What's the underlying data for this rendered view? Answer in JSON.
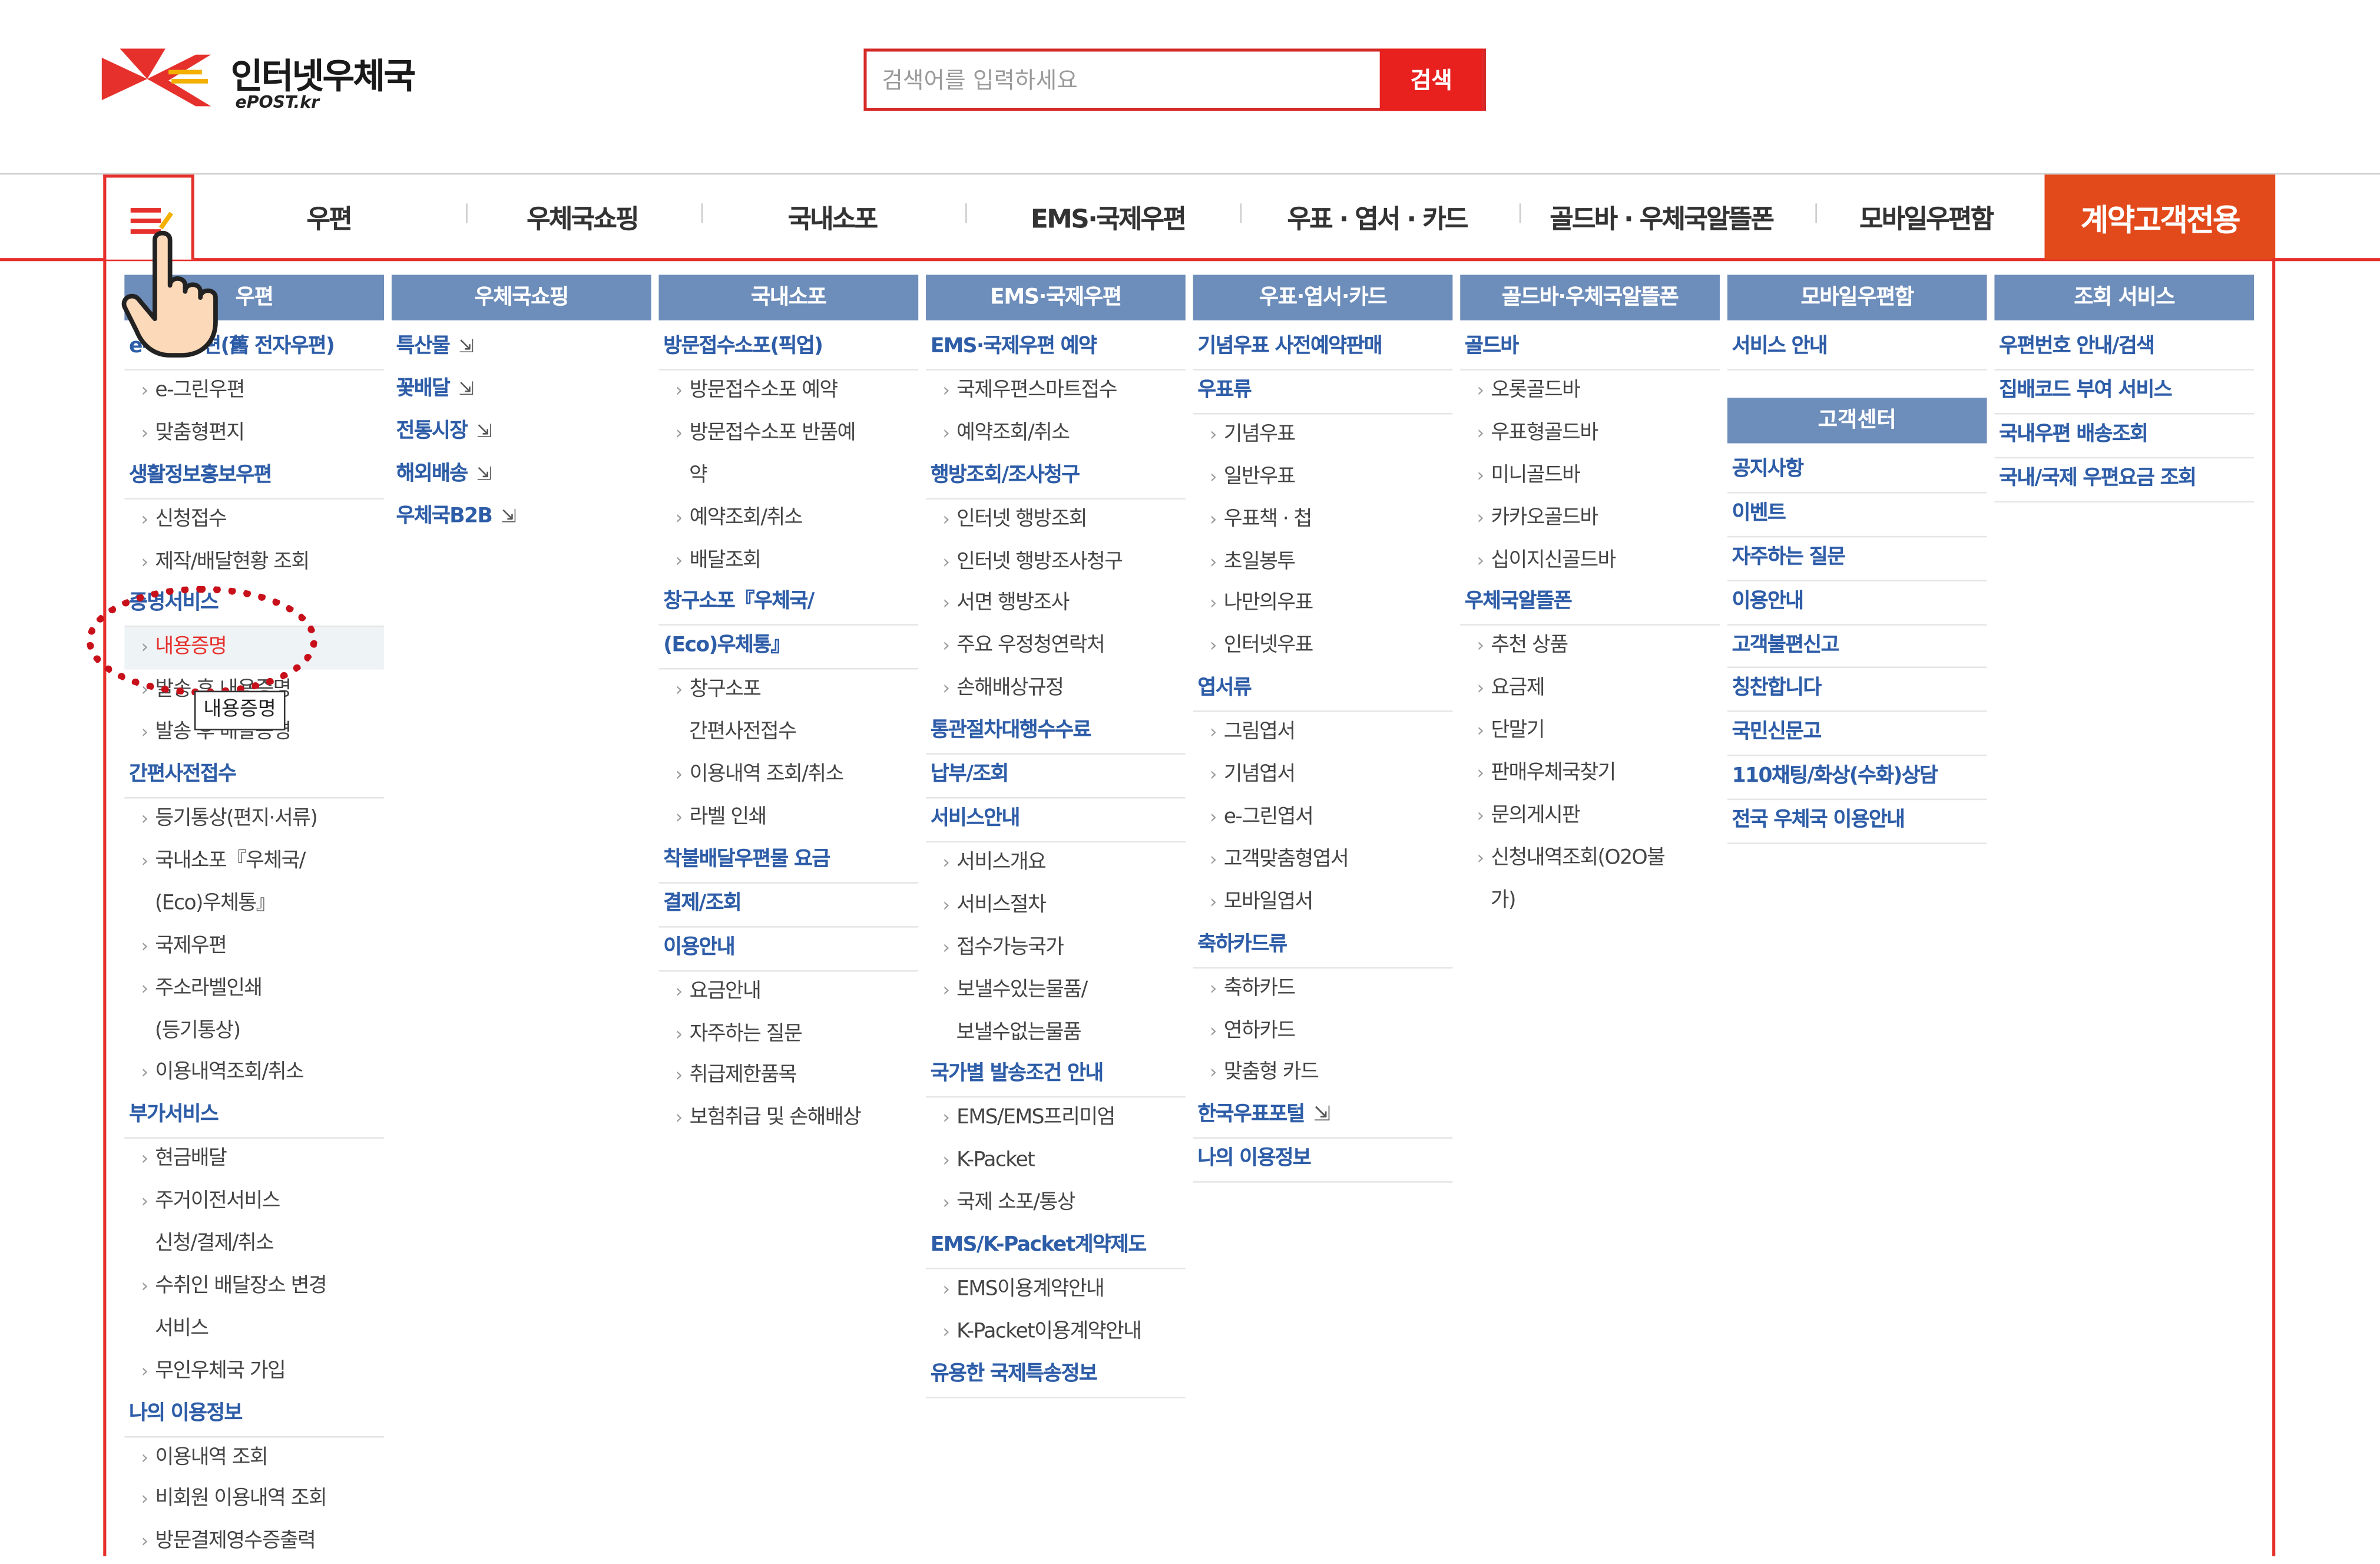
{
  "logo": {
    "title": "인터넷우체국",
    "sub": "ePOST.kr"
  },
  "search": {
    "placeholder": "검색어를 입력하세요",
    "button": "검색"
  },
  "nav": {
    "items": [
      "우편",
      "우체국쇼핑",
      "국내소포",
      "EMS·국제우편",
      "우표 · 엽서 · 카드",
      "골드바 · 우체국알뜰폰",
      "모바일우편함"
    ],
    "special": "계약고객전용"
  },
  "tooltip": "내용증명",
  "columns": [
    {
      "title": "우편",
      "items": [
        {
          "t": "cat",
          "label": "e-그린우편(舊 전자우편)"
        },
        {
          "t": "sub",
          "label": "e-그린우편"
        },
        {
          "t": "sub",
          "label": "맞춤형편지"
        },
        {
          "t": "cat",
          "label": "생활정보홍보우편"
        },
        {
          "t": "sub",
          "label": "신청접수"
        },
        {
          "t": "sub",
          "label": "제작/배달현황 조회"
        },
        {
          "t": "cat",
          "label": "증명서비스"
        },
        {
          "t": "sub",
          "label": "내용증명",
          "active": true
        },
        {
          "t": "sub",
          "label": "발송 후 내용증명"
        },
        {
          "t": "sub",
          "label": "발송 후 배달증명"
        },
        {
          "t": "cat",
          "label": "간편사전접수"
        },
        {
          "t": "sub",
          "label": "등기통상(편지·서류)"
        },
        {
          "t": "sub",
          "label": "국내소포『우체국/"
        },
        {
          "t": "cont",
          "label": "(Eco)우체통』"
        },
        {
          "t": "sub",
          "label": "국제우편"
        },
        {
          "t": "sub",
          "label": "주소라벨인쇄"
        },
        {
          "t": "cont",
          "label": "(등기통상)"
        },
        {
          "t": "sub",
          "label": "이용내역조회/취소"
        },
        {
          "t": "cat",
          "label": "부가서비스"
        },
        {
          "t": "sub",
          "label": "현금배달"
        },
        {
          "t": "sub",
          "label": "주거이전서비스"
        },
        {
          "t": "cont",
          "label": "신청/결제/취소"
        },
        {
          "t": "sub",
          "label": "수취인 배달장소 변경"
        },
        {
          "t": "cont",
          "label": "서비스"
        },
        {
          "t": "sub",
          "label": "무인우체국 가입"
        },
        {
          "t": "cat",
          "label": "나의 이용정보"
        },
        {
          "t": "sub",
          "label": "이용내역 조회"
        },
        {
          "t": "sub",
          "label": "비회원 이용내역 조회"
        },
        {
          "t": "sub",
          "label": "방문결제영수증출력"
        }
      ]
    },
    {
      "title": "우체국쇼핑",
      "items": [
        {
          "t": "ext",
          "label": "특산물"
        },
        {
          "t": "ext",
          "label": "꽃배달"
        },
        {
          "t": "ext",
          "label": "전통시장"
        },
        {
          "t": "ext",
          "label": "해외배송"
        },
        {
          "t": "ext",
          "label": "우체국B2B"
        }
      ]
    },
    {
      "title": "국내소포",
      "items": [
        {
          "t": "cat",
          "label": "방문접수소포(픽업)"
        },
        {
          "t": "sub",
          "label": "방문접수소포 예약"
        },
        {
          "t": "sub",
          "label": "방문접수소포 반품예"
        },
        {
          "t": "cont",
          "label": "약"
        },
        {
          "t": "sub",
          "label": "예약조회/취소"
        },
        {
          "t": "sub",
          "label": "배달조회"
        },
        {
          "t": "cat",
          "label": "창구소포『우체국/"
        },
        {
          "t": "cat",
          "label": "(Eco)우체통』"
        },
        {
          "t": "sub",
          "label": "창구소포"
        },
        {
          "t": "cont",
          "label": "간편사전접수"
        },
        {
          "t": "sub",
          "label": "이용내역 조회/취소"
        },
        {
          "t": "sub",
          "label": "라벨 인쇄"
        },
        {
          "t": "cat",
          "label": "착불배달우편물 요금"
        },
        {
          "t": "cat",
          "label": "결제/조회"
        },
        {
          "t": "cat",
          "label": "이용안내"
        },
        {
          "t": "sub",
          "label": "요금안내"
        },
        {
          "t": "sub",
          "label": "자주하는 질문"
        },
        {
          "t": "sub",
          "label": "취급제한품목"
        },
        {
          "t": "sub",
          "label": "보험취급 및 손해배상"
        }
      ]
    },
    {
      "title": "EMS·국제우편",
      "items": [
        {
          "t": "cat",
          "label": "EMS·국제우편 예약"
        },
        {
          "t": "sub",
          "label": "국제우편스마트접수"
        },
        {
          "t": "sub",
          "label": "예약조회/취소"
        },
        {
          "t": "cat",
          "label": "행방조회/조사청구"
        },
        {
          "t": "sub",
          "label": "인터넷 행방조회"
        },
        {
          "t": "sub",
          "label": "인터넷 행방조사청구"
        },
        {
          "t": "sub",
          "label": "서면 행방조사"
        },
        {
          "t": "sub",
          "label": "주요 우정청연락처"
        },
        {
          "t": "sub",
          "label": "손해배상규정"
        },
        {
          "t": "cat",
          "label": "통관절차대행수수료"
        },
        {
          "t": "cat",
          "label": "납부/조회"
        },
        {
          "t": "cat",
          "label": "서비스안내"
        },
        {
          "t": "sub",
          "label": "서비스개요"
        },
        {
          "t": "sub",
          "label": "서비스절차"
        },
        {
          "t": "sub",
          "label": "접수가능국가"
        },
        {
          "t": "sub",
          "label": "보낼수있는물품/"
        },
        {
          "t": "cont",
          "label": "보낼수없는물품"
        },
        {
          "t": "cat",
          "label": "국가별 발송조건 안내"
        },
        {
          "t": "sub",
          "label": "EMS/EMS프리미엄"
        },
        {
          "t": "sub",
          "label": "K-Packet"
        },
        {
          "t": "sub",
          "label": "국제 소포/통상"
        },
        {
          "t": "cat",
          "label": "EMS/K-Packet계약제도"
        },
        {
          "t": "sub",
          "label": "EMS이용계약안내"
        },
        {
          "t": "sub",
          "label": "K-Packet이용계약안내"
        },
        {
          "t": "cat",
          "label": "유용한 국제특송정보"
        }
      ]
    },
    {
      "title": "우표·엽서·카드",
      "items": [
        {
          "t": "cat",
          "label": "기념우표 사전예약판매"
        },
        {
          "t": "cat",
          "label": "우표류"
        },
        {
          "t": "sub",
          "label": "기념우표"
        },
        {
          "t": "sub",
          "label": "일반우표"
        },
        {
          "t": "sub",
          "label": "우표책 · 첩"
        },
        {
          "t": "sub",
          "label": "초일봉투"
        },
        {
          "t": "sub",
          "label": "나만의우표"
        },
        {
          "t": "sub",
          "label": "인터넷우표"
        },
        {
          "t": "cat",
          "label": "엽서류"
        },
        {
          "t": "sub",
          "label": "그림엽서"
        },
        {
          "t": "sub",
          "label": "기념엽서"
        },
        {
          "t": "sub",
          "label": "e-그린엽서"
        },
        {
          "t": "sub",
          "label": "고객맞춤형엽서"
        },
        {
          "t": "sub",
          "label": "모바일엽서"
        },
        {
          "t": "cat",
          "label": "축하카드류"
        },
        {
          "t": "sub",
          "label": "축하카드"
        },
        {
          "t": "sub",
          "label": "연하카드"
        },
        {
          "t": "sub",
          "label": "맞춤형 카드"
        },
        {
          "t": "cat",
          "label": "한국우표포털",
          "ext": true
        },
        {
          "t": "cat",
          "label": "나의 이용정보"
        }
      ]
    },
    {
      "title": "골드바·우체국알뜰폰",
      "items": [
        {
          "t": "cat",
          "label": "골드바"
        },
        {
          "t": "sub",
          "label": "오롯골드바"
        },
        {
          "t": "sub",
          "label": "우표형골드바"
        },
        {
          "t": "sub",
          "label": "미니골드바"
        },
        {
          "t": "sub",
          "label": "카카오골드바"
        },
        {
          "t": "sub",
          "label": "십이지신골드바"
        },
        {
          "t": "cat",
          "label": "우체국알뜰폰"
        },
        {
          "t": "sub",
          "label": "추천 상품"
        },
        {
          "t": "sub",
          "label": "요금제"
        },
        {
          "t": "sub",
          "label": "단말기"
        },
        {
          "t": "sub",
          "label": "판매우체국찾기"
        },
        {
          "t": "sub",
          "label": "문의게시판"
        },
        {
          "t": "sub",
          "label": "신청내역조회(O2O불"
        },
        {
          "t": "cont",
          "label": "가)"
        }
      ]
    },
    {
      "title": "모바일우편함",
      "items": [
        {
          "t": "cat",
          "label": "서비스 안내"
        }
      ],
      "cs_title": "고객센터",
      "cs_items": [
        "공지사항",
        "이벤트",
        "자주하는 질문",
        "이용안내",
        "고객불편신고",
        "칭찬합니다",
        "국민신문고",
        "110채팅/화상(수화)상담",
        "전국 우체국 이용안내"
      ]
    },
    {
      "title": "조회 서비스",
      "items": [
        {
          "t": "cat",
          "label": "우편번호 안내/검색"
        },
        {
          "t": "cat",
          "label": "집배코드 부여 서비스"
        },
        {
          "t": "cat",
          "label": "국내우편 배송조회"
        },
        {
          "t": "cat",
          "label": "국내/국제 우편요금 조회"
        }
      ]
    }
  ],
  "colors": {
    "brand_red": "#e6302c",
    "special_orange": "#e24a1c",
    "column_header": "#6d8dba",
    "category_blue": "#2e5da8"
  },
  "icons": {
    "logo": "epost-logo-icon",
    "menu": "hamburger-icon",
    "external": "external-link-icon",
    "cursor": "hand-pointer-icon"
  }
}
